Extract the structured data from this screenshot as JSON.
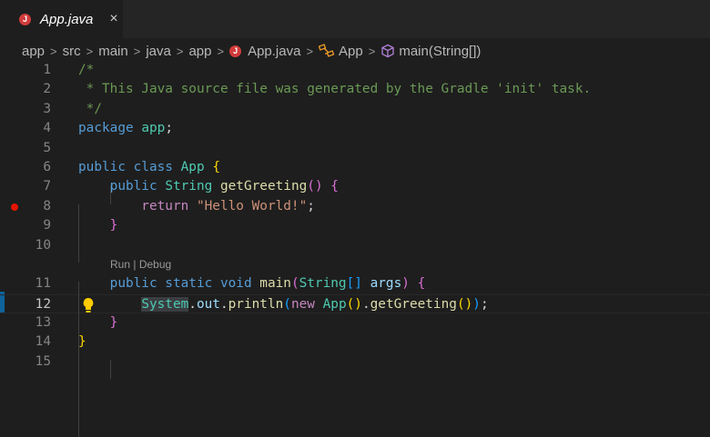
{
  "tab": {
    "label": "App.java",
    "close": "×",
    "icon_letter": "J"
  },
  "breadcrumb": [
    "app",
    "src",
    "main",
    "java",
    "app",
    "App.java",
    "App",
    "main(String[])"
  ],
  "codelens": {
    "run": "Run",
    "sep": " | ",
    "debug": "Debug"
  },
  "lines": [
    {
      "n": "1",
      "t": [
        [
          "/*",
          "cm"
        ]
      ]
    },
    {
      "n": "2",
      "t": [
        [
          " * This Java source file was generated by the Gradle 'init' task.",
          "cm"
        ]
      ]
    },
    {
      "n": "3",
      "t": [
        [
          " */",
          "cm"
        ]
      ]
    },
    {
      "n": "4",
      "t": [
        [
          "package ",
          "kw"
        ],
        [
          "app",
          "ty"
        ],
        [
          ";",
          ""
        ]
      ]
    },
    {
      "n": "5",
      "t": []
    },
    {
      "n": "6",
      "t": [
        [
          "public class ",
          "kw"
        ],
        [
          "App",
          "ty"
        ],
        [
          " ",
          ""
        ],
        [
          "{",
          "b1"
        ]
      ]
    },
    {
      "n": "7",
      "t": [
        [
          "    public ",
          "kw"
        ],
        [
          "String",
          "ty"
        ],
        [
          " ",
          ""
        ],
        [
          "getGreeting",
          "fn"
        ],
        [
          "()",
          "b2"
        ],
        [
          " ",
          ""
        ],
        [
          "{",
          "b2"
        ]
      ]
    },
    {
      "n": "8",
      "bp": true,
      "t": [
        [
          "        return ",
          "ctl"
        ],
        [
          "\"Hello World!\"",
          "st"
        ],
        [
          ";",
          ""
        ]
      ]
    },
    {
      "n": "9",
      "t": [
        [
          "    }",
          "b2"
        ]
      ]
    },
    {
      "n": "10",
      "t": []
    },
    {
      "lens": true
    },
    {
      "n": "11",
      "t": [
        [
          "    public static void ",
          "kw"
        ],
        [
          "main",
          "fn"
        ],
        [
          "(",
          "b2"
        ],
        [
          "String",
          "ty"
        ],
        [
          "[]",
          "b3"
        ],
        [
          " ",
          ""
        ],
        [
          "args",
          "var"
        ],
        [
          ")",
          "b2"
        ],
        [
          " ",
          ""
        ],
        [
          "{",
          "b2"
        ]
      ]
    },
    {
      "n": "12",
      "cur": true,
      "bulb": true,
      "t": [
        [
          "        ",
          ""
        ],
        [
          "System",
          "ty hl"
        ],
        [
          ".",
          ""
        ],
        [
          "out",
          "var"
        ],
        [
          ".",
          ""
        ],
        [
          "println",
          "fn"
        ],
        [
          "(",
          "b3"
        ],
        [
          "new ",
          "ctl"
        ],
        [
          "App",
          "ty"
        ],
        [
          "()",
          "b1"
        ],
        [
          ".",
          ""
        ],
        [
          "getGreeting",
          "fn"
        ],
        [
          "()",
          "b1"
        ],
        [
          ")",
          "b3"
        ],
        [
          ";",
          ""
        ]
      ]
    },
    {
      "n": "13",
      "t": [
        [
          "    }",
          "b2"
        ]
      ]
    },
    {
      "n": "14",
      "t": [
        [
          "}",
          "b1"
        ]
      ]
    },
    {
      "n": "15",
      "t": []
    }
  ]
}
